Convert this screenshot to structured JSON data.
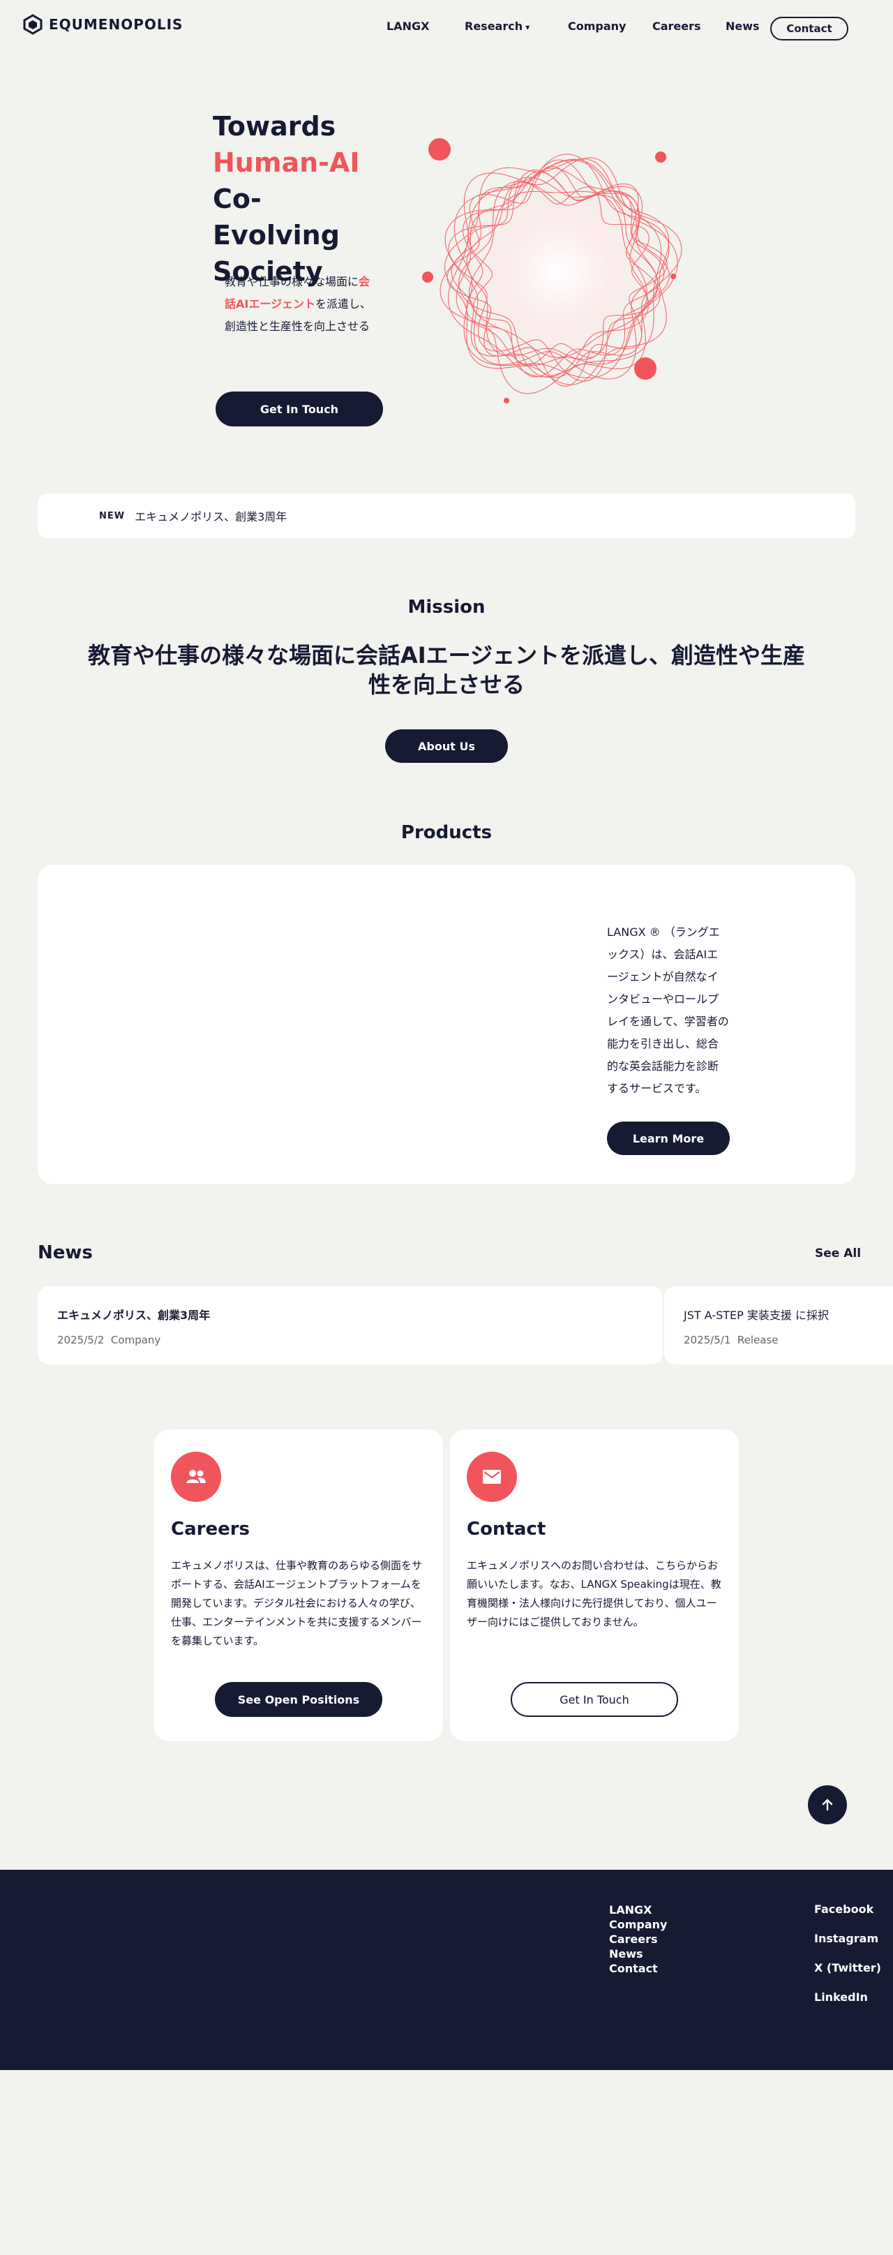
{
  "header": {
    "logo_text": "EQUMENOPOLIS",
    "nav": [
      "LANGX",
      "Research",
      "Company",
      "Careers",
      "News"
    ],
    "contact_label": "Contact"
  },
  "hero": {
    "title_part1": "Towards ",
    "title_accent": "Human-AI",
    "title_part2": " Co-Evolving Society",
    "sub_part1": "教育や仕事の様々な場面に",
    "sub_accent": "会話AIエージェント",
    "sub_part2": "を派遣し、創造性と生産性を向上させる",
    "cta": "Get In Touch"
  },
  "banner": {
    "tag": "NEW",
    "text": "エキュメノポリス、創業3周年"
  },
  "mission": {
    "title": "Mission",
    "text": "教育や仕事の様々な場面に会話AIエージェントを派遣し、創造性や生産性を向上させる",
    "button": "About Us"
  },
  "products": {
    "title": "Products",
    "description": "LANGX ® （ラングエックス）は、会話AIエージェントが自然なインタビューやロールプレイを通して、学習者の能力を引き出し、総合的な英会話能力を診断するサービスです。",
    "button": "Learn More"
  },
  "news": {
    "title": "News",
    "see_all": "See All",
    "items": [
      {
        "title": "エキュメノポリス、創業3周年",
        "date": "2025/5/2",
        "category": "Company"
      },
      {
        "title": "JST A-STEP 実装支援 に採択",
        "date": "2025/5/1",
        "category": "Release"
      }
    ]
  },
  "careers": {
    "title": "Careers",
    "text": "エキュメノポリスは、仕事や教育のあらゆる側面をサポートする、会話AIエージェントプラットフォームを開発しています。デジタル社会における人々の学び、仕事、エンターテインメントを共に支援するメンバーを募集しています。",
    "button": "See Open Positions",
    "icon": "people-icon"
  },
  "contact": {
    "title": "Contact",
    "text": "エキュメノポリスへのお問い合わせは、こちらからお願いいたします。なお、LANGX Speakingは現在、教育機関様・法人様向けに先行提供しており、個人ユーザー向けにはご提供しておりません。",
    "button": "Get In Touch",
    "icon": "mail-icon"
  },
  "footer": {
    "links": [
      "LANGX",
      "Company",
      "Careers",
      "News",
      "Contact"
    ],
    "social": [
      "Facebook",
      "Instagram",
      "X (Twitter)",
      "LinkedIn"
    ]
  },
  "colors": {
    "accent": "#f2545b",
    "navy": "#161a33",
    "background": "#f2f2ee"
  }
}
